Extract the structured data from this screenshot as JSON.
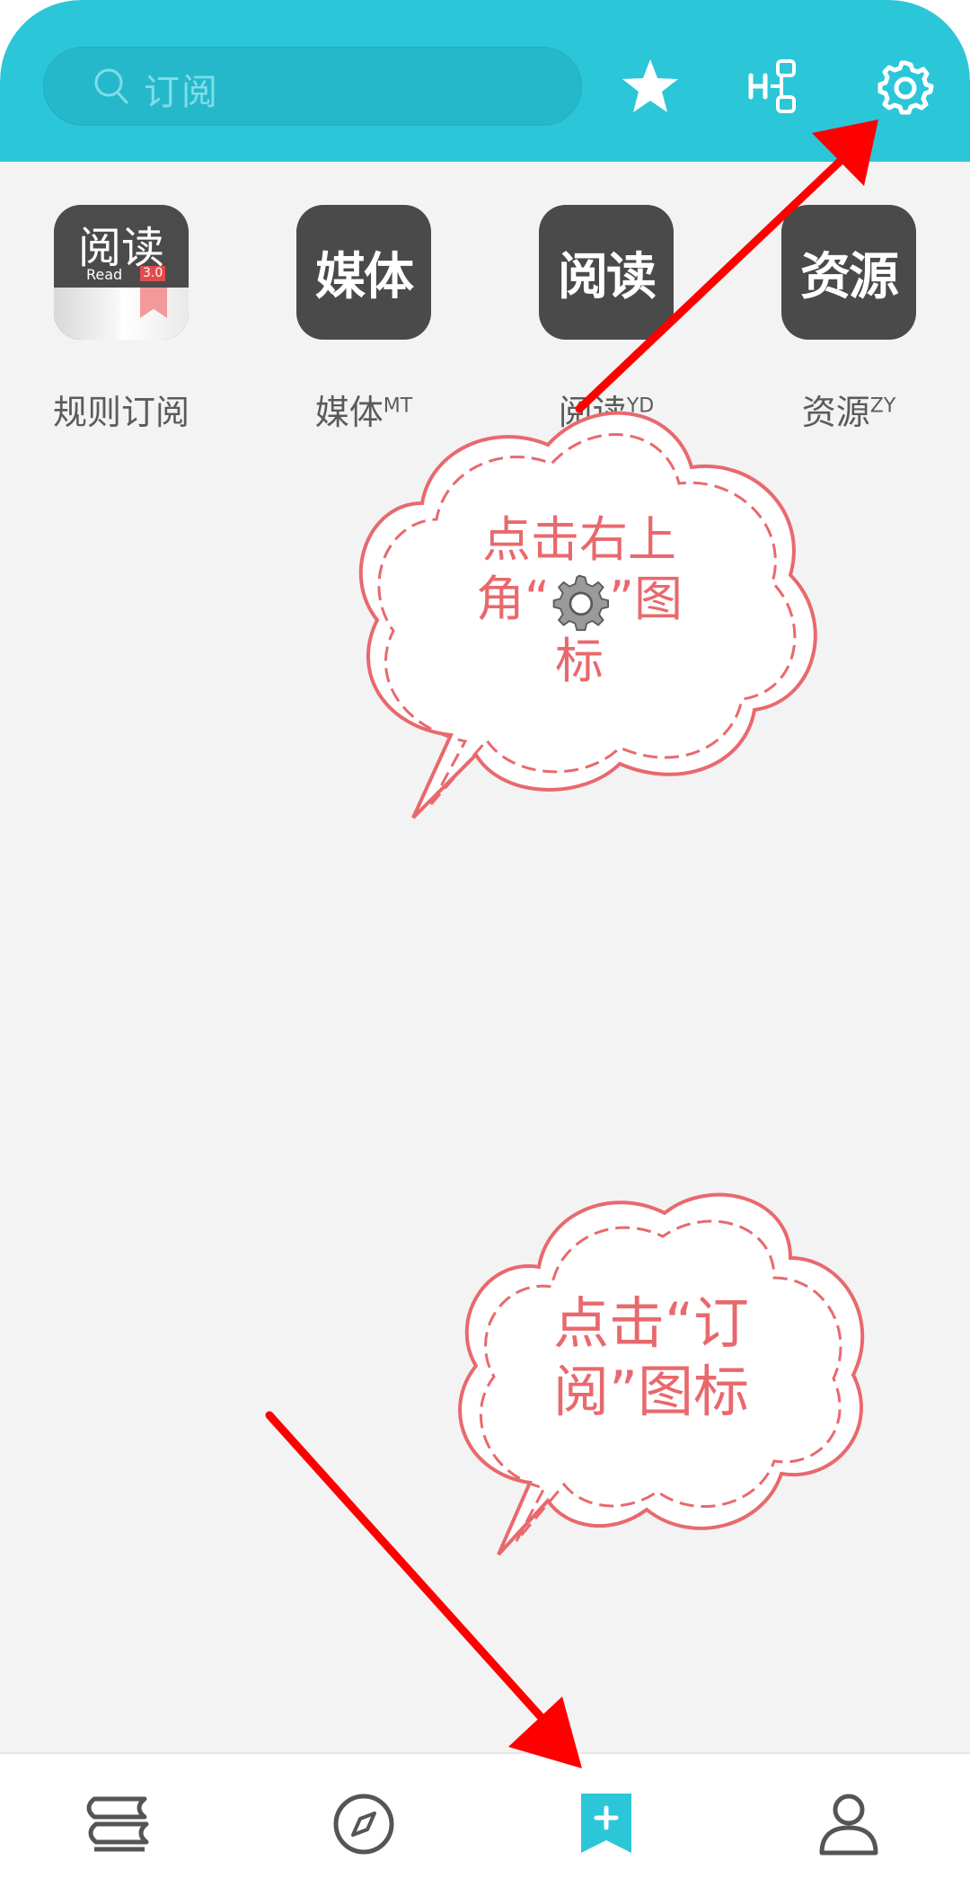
{
  "search": {
    "placeholder": "订阅"
  },
  "subscriptions": [
    {
      "label": "规则订阅",
      "glyph": "阅读",
      "sub": "Read",
      "version": "3.0",
      "sup": ""
    },
    {
      "label": "媒体",
      "sup": "MT",
      "glyph": "媒体"
    },
    {
      "label": "阅读",
      "sup": "YD",
      "glyph": "阅读"
    },
    {
      "label": "资源",
      "sup": "ZY",
      "glyph": "资源"
    }
  ],
  "annotations": {
    "top": {
      "line1": "点击右上",
      "line2_before": "角“",
      "line2_after": "”图",
      "line3": "标"
    },
    "bottom": {
      "line1": "点击“订",
      "line2": "阅”图标"
    }
  },
  "colors": {
    "accent": "#2cc6d9",
    "bubble_text": "#e8696d",
    "arrow": "#ff0000",
    "tile_bg": "#4a4a4a"
  },
  "icons": {
    "toolbar": [
      "star-icon",
      "rule-tree-icon",
      "settings-gear-icon"
    ],
    "nav": [
      "bookshelf-icon",
      "explore-compass-icon",
      "subscription-icon",
      "profile-icon"
    ]
  },
  "nav": {
    "active": "subscription"
  }
}
